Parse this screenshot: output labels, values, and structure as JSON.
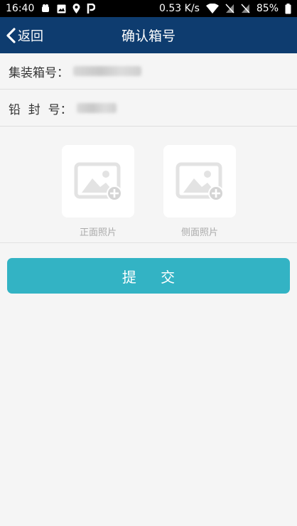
{
  "status_bar": {
    "time": "16:40",
    "left_icons": [
      "notification-icon",
      "image-icon",
      "location-icon",
      "parking-icon"
    ],
    "network_speed": "0.53 K/s",
    "battery": "85%",
    "right_icons": [
      "wifi-icon",
      "no-sim-icon",
      "no-sim-icon",
      "battery-icon"
    ]
  },
  "nav": {
    "back_label": "返回",
    "title": "确认箱号",
    "background": "#0e3c6f"
  },
  "form": {
    "container_label": "集装箱号：",
    "seal_label": "铅  封  号："
  },
  "photos": {
    "front_caption": "正面照片",
    "side_caption": "侧面照片",
    "icon": "add-image-icon"
  },
  "submit": {
    "label": "提 交",
    "color": "#33b3c4"
  }
}
